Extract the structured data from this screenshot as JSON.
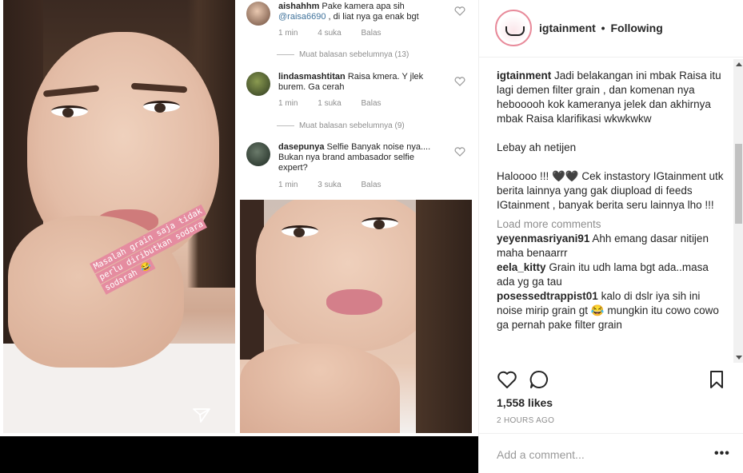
{
  "post_image": {
    "sticker_lines": [
      "Masalah grain saja tidak",
      "perlu diributkan sodara",
      "sodarah 😂"
    ],
    "screenshot_comments": [
      {
        "username": "aishahhm",
        "text": "Pake kamera apa sih",
        "mention": "@raisa6690",
        "text_after": ", di liat nya ga enak bgt",
        "time": "1 min",
        "likes": "4 suka",
        "reply": "Balas"
      },
      {
        "username": "lindasmashtitan",
        "text": "Raisa kmera. Y jlek burem. Ga cerah",
        "time": "1 min",
        "likes": "1 suka",
        "reply": "Balas"
      },
      {
        "username": "dasepunya",
        "text": "Selfie Banyak noise nya.... Bukan nya brand ambasador selfie expert?",
        "time": "1 min",
        "likes": "3 suka",
        "reply": "Balas"
      }
    ],
    "view_replies": [
      "Muat balasan sebelumnya (13)",
      "Muat balasan sebelumnya (9)"
    ]
  },
  "header": {
    "username": "igtainment",
    "separator": "•",
    "follow_status": "Following"
  },
  "caption": {
    "username": "igtainment",
    "paragraphs": [
      "Jadi belakangan ini mbak Raisa itu lagi demen filter grain , dan komenan nya hebooooh kok kameranya jelek dan akhirnya mbak Raisa klarifikasi wkwkwkw",
      "Lebay ah netijen",
      "Haloooo !!! 🖤🖤 Cek instastory IGtainment utk berita lainnya yang gak diupload di feeds IGtainment , banyak berita seru lainnya lho !!!"
    ]
  },
  "load_more_label": "Load more comments",
  "comments": [
    {
      "username": "yeyenmasriyani91",
      "text": "Ahh emang dasar nitijen maha benaarrr"
    },
    {
      "username": "eela_kitty",
      "text": "Grain itu udh lama bgt ada..masa ada yg ga tau"
    },
    {
      "username": "posessedtrappist01",
      "text": "kalo di dslr iya sih ini noise mirip grain gt 😂 mungkin itu cowo cowo ga pernah pake filter grain"
    }
  ],
  "actions": {
    "like_icon": "heart-icon",
    "comment_icon": "comment-icon",
    "save_icon": "bookmark-icon"
  },
  "likes_text": "1,558 likes",
  "timestamp": "2 HOURS AGO",
  "add_comment": {
    "placeholder": "Add a comment...",
    "more_label": "•••"
  },
  "colors": {
    "text": "#262626",
    "muted": "#8e8e8e",
    "sticker_bg": "#e58ca0",
    "border": "#efefef"
  }
}
